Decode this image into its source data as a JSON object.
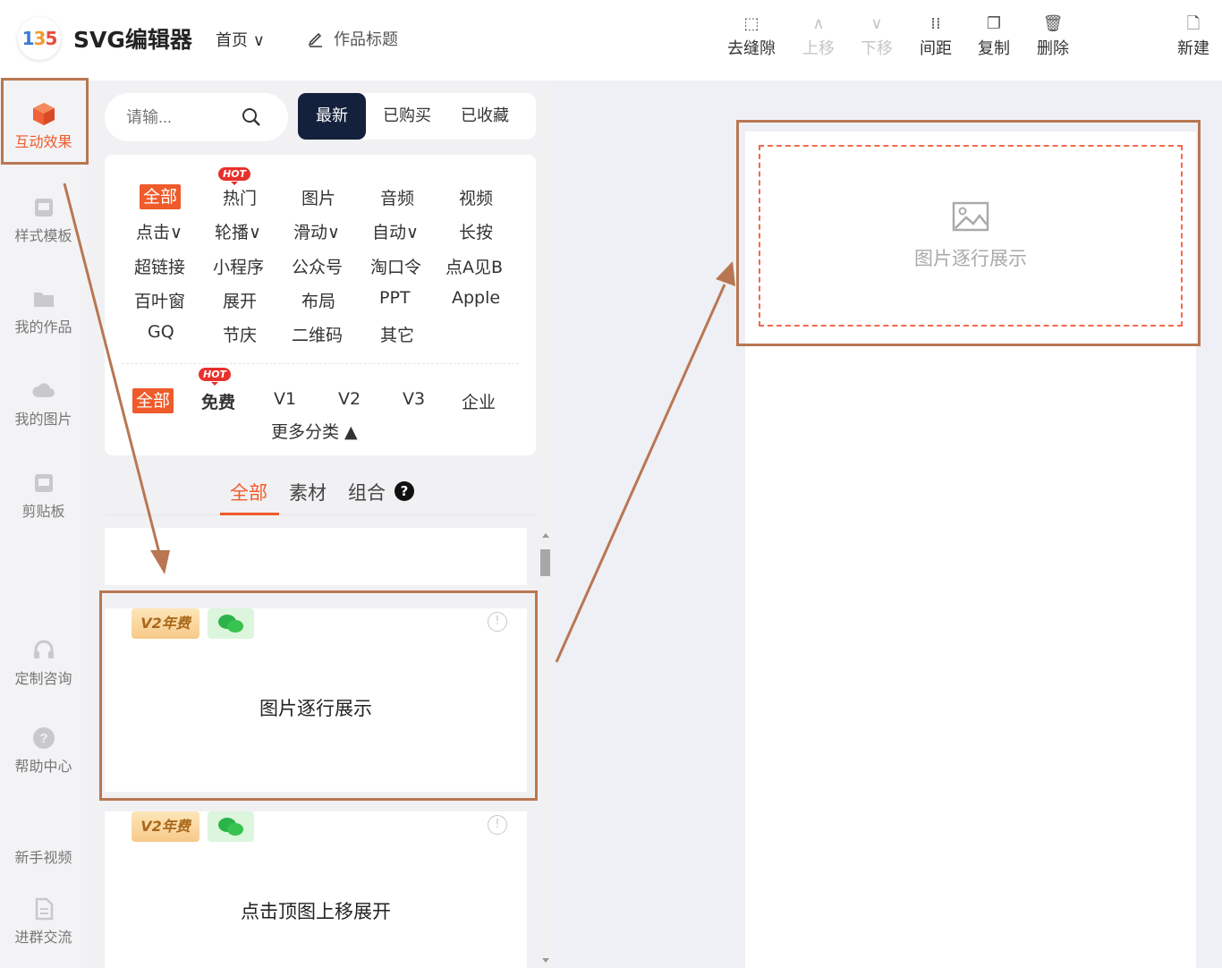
{
  "header": {
    "logo_text": "135",
    "app_title": "SVG编辑器",
    "nav_home": "首页",
    "nav_work_title": "作品标题",
    "tools": [
      {
        "label": "去缝隙",
        "icon": "gap-icon",
        "enabled": true
      },
      {
        "label": "上移",
        "icon": "arrow-up-icon",
        "enabled": false
      },
      {
        "label": "下移",
        "icon": "arrow-down-icon",
        "enabled": false
      },
      {
        "label": "间距",
        "icon": "spacing-icon",
        "enabled": true
      },
      {
        "label": "复制",
        "icon": "copy-icon",
        "enabled": true
      },
      {
        "label": "删除",
        "icon": "trash-icon",
        "enabled": true
      },
      {
        "label": "新建",
        "icon": "new-file-icon",
        "enabled": true
      }
    ]
  },
  "sidebar": {
    "items": [
      {
        "label": "互动效果",
        "icon": "cube-icon",
        "active": true
      },
      {
        "label": "样式模板",
        "icon": "template-icon"
      },
      {
        "label": "我的作品",
        "icon": "folder-icon"
      },
      {
        "label": "我的图片",
        "icon": "cloud-icon"
      },
      {
        "label": "剪贴板",
        "icon": "clipboard-icon"
      },
      {
        "label": "定制咨询",
        "icon": "headset-icon"
      },
      {
        "label": "帮助中心",
        "icon": "help-icon"
      },
      {
        "label": "新手视频",
        "icon": ""
      },
      {
        "label": "进群交流",
        "icon": "document-icon"
      }
    ]
  },
  "panel": {
    "search_placeholder": "请输...",
    "sort_tabs": [
      "最新",
      "已购买",
      "已收藏"
    ],
    "hot_badge": "HOT",
    "categories": {
      "row1": [
        "全部",
        "热门",
        "图片",
        "音频",
        "视频"
      ],
      "row2": [
        "点击∨",
        "轮播∨",
        "滑动∨",
        "自动∨",
        "长按"
      ],
      "row3": [
        "超链接",
        "小程序",
        "公众号",
        "淘口令",
        "点A见B"
      ],
      "row4": [
        "百叶窗",
        "展开",
        "布局",
        "PPT",
        "Apple"
      ],
      "row5": [
        "GQ",
        "节庆",
        "二维码",
        "其它"
      ]
    },
    "versions": [
      "全部",
      "免费",
      "V1",
      "V2",
      "V3",
      "企业"
    ],
    "more_categories": "更多分类 ▲",
    "type_tabs": [
      "全部",
      "素材",
      "组合"
    ],
    "help_mark": "?",
    "templates": [
      {
        "badge": "V2年费",
        "name": "图片逐行展示"
      },
      {
        "badge": "V2年费",
        "name": "点击顶图上移展开"
      }
    ],
    "info_mark": "!"
  },
  "canvas": {
    "placeholder_text": "图片逐行展示"
  },
  "colors": {
    "accent": "#ef5b2b",
    "annotation": "#b87752",
    "dark_tab": "#14213d"
  }
}
